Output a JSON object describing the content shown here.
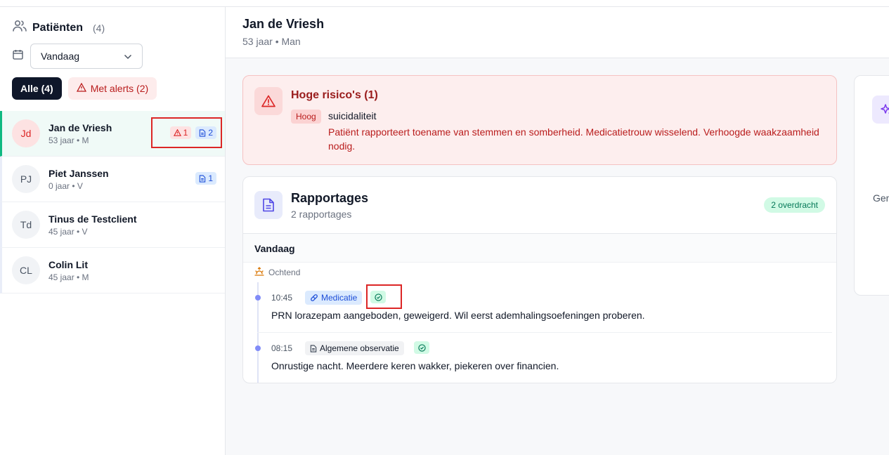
{
  "sidebar": {
    "title": "Patiënten",
    "count": "(4)",
    "date_filter": "Vandaag",
    "filters": {
      "all": "Alle (4)",
      "alerts": "Met alerts (2)"
    },
    "patients": [
      {
        "initials": "Jd",
        "name": "Jan de Vriesh",
        "meta": "53 jaar • M",
        "alert_count": "1",
        "report_count": "2"
      },
      {
        "initials": "PJ",
        "name": "Piet Janssen",
        "meta": "0 jaar • V",
        "report_count": "1"
      },
      {
        "initials": "Td",
        "name": "Tinus de Testclient",
        "meta": "45 jaar • V"
      },
      {
        "initials": "CL",
        "name": "Colin Lit",
        "meta": "45 jaar • M"
      }
    ]
  },
  "header": {
    "name": "Jan de Vriesh",
    "meta": "53 jaar • Man"
  },
  "risk": {
    "title": "Hoge risico's (1)",
    "level": "Hoog",
    "name": "suicidaliteit",
    "description": "Patiënt rapporteert toename van stemmen en somberheid. Medicatietrouw wisselend. Verhoogde waakzaamheid nodig."
  },
  "reports": {
    "title": "Rapportages",
    "subtitle": "2 rapportages",
    "badge": "2 overdracht",
    "day": "Vandaag",
    "part": "Ochtend",
    "entries": [
      {
        "time": "10:45",
        "category": "Medicatie",
        "text": "PRN lorazepam aangeboden, geweigerd. Wil eerst ademhalingsoefeningen proberen."
      },
      {
        "time": "08:15",
        "category": "Algemene observatie",
        "text": "Onrustige nacht. Meerdere keren wakker, piekeren over financien."
      }
    ]
  },
  "side_panel": {
    "text": "Gen"
  },
  "colors": {
    "accent_green": "#10b981",
    "danger": "#dc2626",
    "primary_dark": "#0f172a",
    "timeline": "#818cf8"
  }
}
